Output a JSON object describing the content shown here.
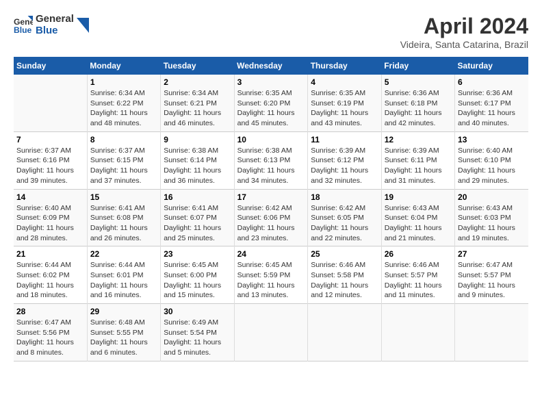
{
  "logo": {
    "line1": "General",
    "line2": "Blue"
  },
  "title": "April 2024",
  "location": "Videira, Santa Catarina, Brazil",
  "weekdays": [
    "Sunday",
    "Monday",
    "Tuesday",
    "Wednesday",
    "Thursday",
    "Friday",
    "Saturday"
  ],
  "weeks": [
    [
      {
        "day": "",
        "info": ""
      },
      {
        "day": "1",
        "info": "Sunrise: 6:34 AM\nSunset: 6:22 PM\nDaylight: 11 hours\nand 48 minutes."
      },
      {
        "day": "2",
        "info": "Sunrise: 6:34 AM\nSunset: 6:21 PM\nDaylight: 11 hours\nand 46 minutes."
      },
      {
        "day": "3",
        "info": "Sunrise: 6:35 AM\nSunset: 6:20 PM\nDaylight: 11 hours\nand 45 minutes."
      },
      {
        "day": "4",
        "info": "Sunrise: 6:35 AM\nSunset: 6:19 PM\nDaylight: 11 hours\nand 43 minutes."
      },
      {
        "day": "5",
        "info": "Sunrise: 6:36 AM\nSunset: 6:18 PM\nDaylight: 11 hours\nand 42 minutes."
      },
      {
        "day": "6",
        "info": "Sunrise: 6:36 AM\nSunset: 6:17 PM\nDaylight: 11 hours\nand 40 minutes."
      }
    ],
    [
      {
        "day": "7",
        "info": "Sunrise: 6:37 AM\nSunset: 6:16 PM\nDaylight: 11 hours\nand 39 minutes."
      },
      {
        "day": "8",
        "info": "Sunrise: 6:37 AM\nSunset: 6:15 PM\nDaylight: 11 hours\nand 37 minutes."
      },
      {
        "day": "9",
        "info": "Sunrise: 6:38 AM\nSunset: 6:14 PM\nDaylight: 11 hours\nand 36 minutes."
      },
      {
        "day": "10",
        "info": "Sunrise: 6:38 AM\nSunset: 6:13 PM\nDaylight: 11 hours\nand 34 minutes."
      },
      {
        "day": "11",
        "info": "Sunrise: 6:39 AM\nSunset: 6:12 PM\nDaylight: 11 hours\nand 32 minutes."
      },
      {
        "day": "12",
        "info": "Sunrise: 6:39 AM\nSunset: 6:11 PM\nDaylight: 11 hours\nand 31 minutes."
      },
      {
        "day": "13",
        "info": "Sunrise: 6:40 AM\nSunset: 6:10 PM\nDaylight: 11 hours\nand 29 minutes."
      }
    ],
    [
      {
        "day": "14",
        "info": "Sunrise: 6:40 AM\nSunset: 6:09 PM\nDaylight: 11 hours\nand 28 minutes."
      },
      {
        "day": "15",
        "info": "Sunrise: 6:41 AM\nSunset: 6:08 PM\nDaylight: 11 hours\nand 26 minutes."
      },
      {
        "day": "16",
        "info": "Sunrise: 6:41 AM\nSunset: 6:07 PM\nDaylight: 11 hours\nand 25 minutes."
      },
      {
        "day": "17",
        "info": "Sunrise: 6:42 AM\nSunset: 6:06 PM\nDaylight: 11 hours\nand 23 minutes."
      },
      {
        "day": "18",
        "info": "Sunrise: 6:42 AM\nSunset: 6:05 PM\nDaylight: 11 hours\nand 22 minutes."
      },
      {
        "day": "19",
        "info": "Sunrise: 6:43 AM\nSunset: 6:04 PM\nDaylight: 11 hours\nand 21 minutes."
      },
      {
        "day": "20",
        "info": "Sunrise: 6:43 AM\nSunset: 6:03 PM\nDaylight: 11 hours\nand 19 minutes."
      }
    ],
    [
      {
        "day": "21",
        "info": "Sunrise: 6:44 AM\nSunset: 6:02 PM\nDaylight: 11 hours\nand 18 minutes."
      },
      {
        "day": "22",
        "info": "Sunrise: 6:44 AM\nSunset: 6:01 PM\nDaylight: 11 hours\nand 16 minutes."
      },
      {
        "day": "23",
        "info": "Sunrise: 6:45 AM\nSunset: 6:00 PM\nDaylight: 11 hours\nand 15 minutes."
      },
      {
        "day": "24",
        "info": "Sunrise: 6:45 AM\nSunset: 5:59 PM\nDaylight: 11 hours\nand 13 minutes."
      },
      {
        "day": "25",
        "info": "Sunrise: 6:46 AM\nSunset: 5:58 PM\nDaylight: 11 hours\nand 12 minutes."
      },
      {
        "day": "26",
        "info": "Sunrise: 6:46 AM\nSunset: 5:57 PM\nDaylight: 11 hours\nand 11 minutes."
      },
      {
        "day": "27",
        "info": "Sunrise: 6:47 AM\nSunset: 5:57 PM\nDaylight: 11 hours\nand 9 minutes."
      }
    ],
    [
      {
        "day": "28",
        "info": "Sunrise: 6:47 AM\nSunset: 5:56 PM\nDaylight: 11 hours\nand 8 minutes."
      },
      {
        "day": "29",
        "info": "Sunrise: 6:48 AM\nSunset: 5:55 PM\nDaylight: 11 hours\nand 6 minutes."
      },
      {
        "day": "30",
        "info": "Sunrise: 6:49 AM\nSunset: 5:54 PM\nDaylight: 11 hours\nand 5 minutes."
      },
      {
        "day": "",
        "info": ""
      },
      {
        "day": "",
        "info": ""
      },
      {
        "day": "",
        "info": ""
      },
      {
        "day": "",
        "info": ""
      }
    ]
  ]
}
